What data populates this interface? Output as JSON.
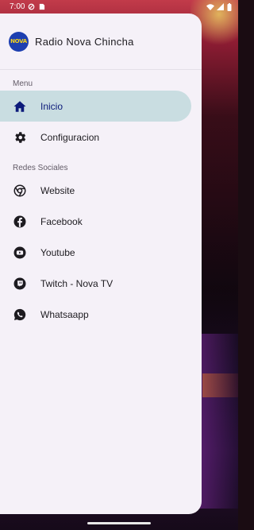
{
  "status_bar": {
    "time": "7:00"
  },
  "drawer": {
    "app_title": "Radio Nova Chincha",
    "logo_text": "NOVA",
    "sections": [
      {
        "label": "Menu"
      },
      {
        "label": "Redes Sociales"
      }
    ],
    "menu_items": [
      {
        "label": "Inicio",
        "icon": "home-icon",
        "active": true
      },
      {
        "label": "Configuracion",
        "icon": "gear-icon",
        "active": false
      }
    ],
    "social_items": [
      {
        "label": "Website",
        "icon": "chrome-icon"
      },
      {
        "label": "Facebook",
        "icon": "facebook-icon"
      },
      {
        "label": "Youtube",
        "icon": "youtube-icon"
      },
      {
        "label": "Twitch - Nova TV",
        "icon": "twitch-icon"
      },
      {
        "label": "Whatsaapp",
        "icon": "whatsapp-icon"
      }
    ]
  },
  "colors": {
    "drawer_bg": "#f5f1f8",
    "active_bg": "#c9dde1",
    "active_text": "#0c1a7a",
    "icon_dark": "#1d1b20"
  }
}
